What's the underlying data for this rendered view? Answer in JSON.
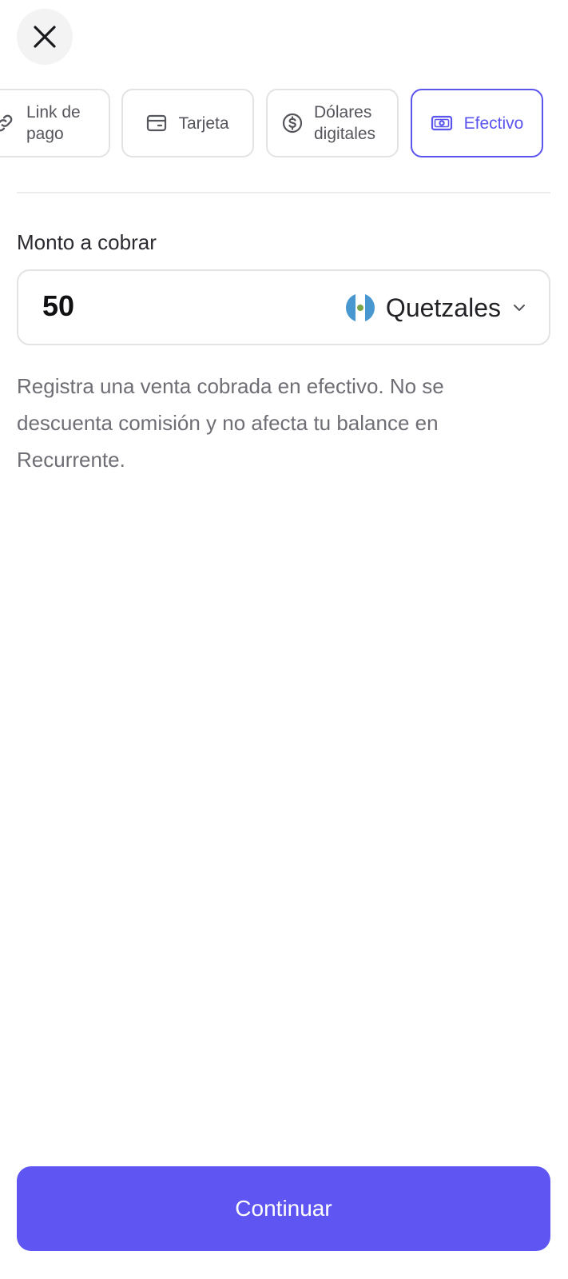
{
  "payment_methods": [
    {
      "label": "Link de pago",
      "icon": "link-icon",
      "active": false
    },
    {
      "label": "Tarjeta",
      "icon": "credit-card-icon",
      "active": false
    },
    {
      "label": "Dólares digitales",
      "icon": "dollar-circle-icon",
      "active": false
    },
    {
      "label": "Efectivo",
      "icon": "cash-icon",
      "active": true
    }
  ],
  "amount": {
    "label": "Monto a cobrar",
    "value": "50",
    "currency": "Quetzales",
    "currency_flag": "guatemala-flag-icon"
  },
  "description": "Registra una venta cobrada en efectivo. No se descuenta comisión y no afecta tu balance en Recurrente.",
  "continue_label": "Continuar",
  "colors": {
    "accent": "#5f55f2",
    "active_border": "#5b55ee",
    "border": "#e3e3e6",
    "muted_text": "#6e6e75"
  }
}
